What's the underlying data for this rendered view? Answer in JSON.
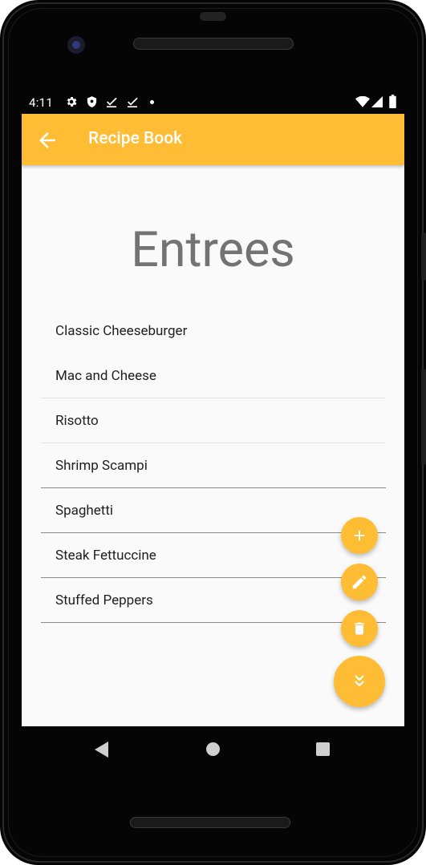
{
  "status_bar": {
    "time": "4:11",
    "left_icons": [
      "gear-icon",
      "shield-icon",
      "download-check-icon",
      "download-check-icon",
      "dot-icon"
    ],
    "right_icons": [
      "wifi-icon",
      "cellular-icon",
      "battery-icon"
    ]
  },
  "app_bar": {
    "title": "Recipe Book",
    "background": "#ffbd36",
    "back_icon": "arrow-back-icon"
  },
  "page": {
    "heading": "Entrees"
  },
  "recipes": [
    "Classic Cheeseburger",
    "Mac and Cheese",
    "Risotto",
    "Shrimp Scampi",
    "Spaghetti",
    "Steak Fettuccine",
    "Stuffed Peppers"
  ],
  "fab_menu": {
    "color": "#ffbd36",
    "actions": [
      {
        "name": "add",
        "icon": "plus-icon"
      },
      {
        "name": "edit",
        "icon": "pencil-icon"
      },
      {
        "name": "delete",
        "icon": "trash-icon"
      }
    ],
    "toggle_icon": "double-chevron-down-icon"
  },
  "nav_bar": {
    "buttons": [
      "back-triangle-icon",
      "home-circle-icon",
      "recents-square-icon"
    ]
  }
}
